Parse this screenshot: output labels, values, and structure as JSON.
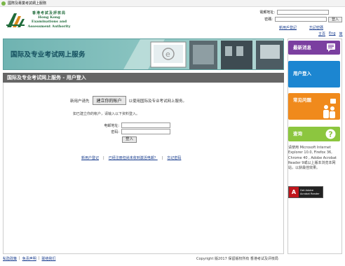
{
  "window": {
    "title": "國際及專業考試網上服務"
  },
  "logo": {
    "cn": "香港考試及評核局",
    "en1": "Hong Kong",
    "en2": "Examinations and",
    "en3": "Assessment Authority"
  },
  "login_box": {
    "email_label": "電郵地址:",
    "password_label": "密碼:",
    "login_button": "登入",
    "new_user_register": "新用戶登記",
    "forgot_password": "忘記密碼",
    "home": "主頁",
    "eng": "Eng",
    "simplified": "简"
  },
  "banner": {
    "title": "国际及专业考试网上服务"
  },
  "subhead": {
    "title": "国际及专业考试网上服务 - 用户登入"
  },
  "main": {
    "new_user_prefix": "新用户请先",
    "create_account_button": "建立你的帐户",
    "new_user_suffix": "以使用国际及专业考试网上服务。",
    "existing_user_text": "如已建立你的帐户，请输入以下资料登入。",
    "email_label": "电邮地址:",
    "password_label": "密码:",
    "login_button": "登入",
    "links": [
      "新用户登记",
      "已经注册但尚未收到激活电邮？",
      "忘记密码"
    ]
  },
  "sidebar": {
    "tiles": [
      {
        "label": "最新消息",
        "color": "#7b3fa0"
      },
      {
        "label": "用户登入",
        "color": "#1c86d1"
      },
      {
        "label": "常见问题",
        "color": "#f08a1c"
      },
      {
        "label": "查询",
        "color": "#8cc63f"
      }
    ],
    "browser_note": "请使用 Microsoft Internet Explorer 10.0, Firefox 36, Chrome 40 , Adobe Acrobat Reader 9或以上版本浏览本网站，以获最佳效果。",
    "adobe_line1": "Get Adobe",
    "adobe_line2": "Acrobat Reader"
  },
  "footer": {
    "links": [
      "私隐政策",
      "免责声明",
      "联络我们"
    ],
    "copyright": "Copyright 版2017 保留版权所有 香港考试及评核局"
  }
}
